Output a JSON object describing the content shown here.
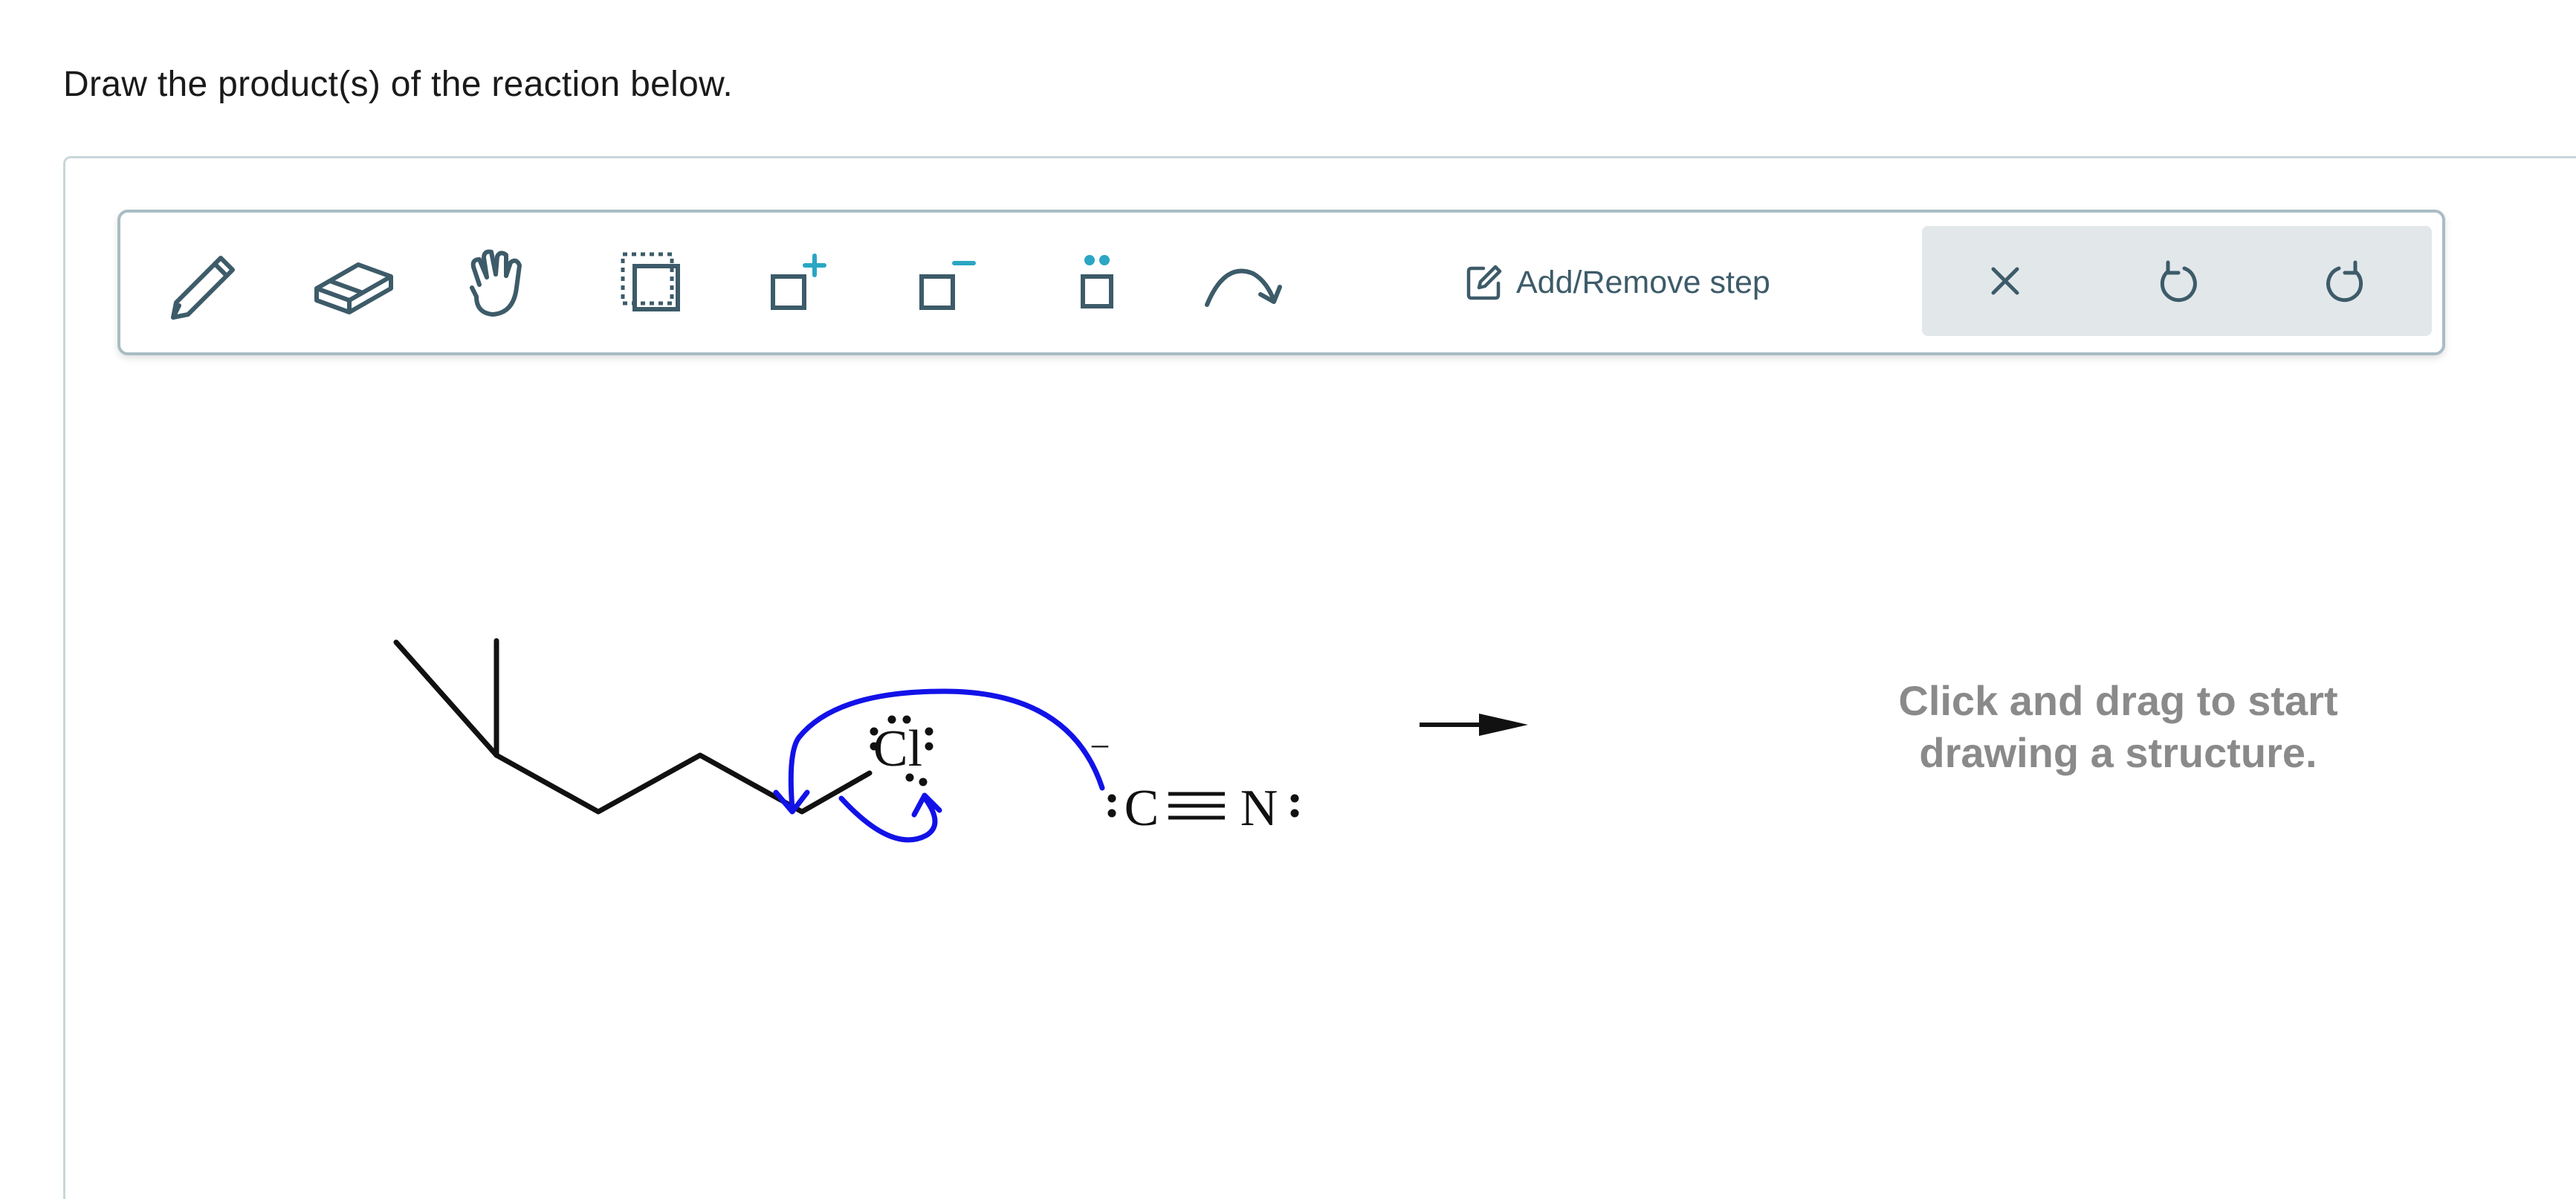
{
  "question": {
    "prompt": "Draw the product(s) of the reaction below."
  },
  "toolbar": {
    "tools": [
      {
        "name": "pencil-tool",
        "icon": "pencil-icon"
      },
      {
        "name": "eraser-tool",
        "icon": "eraser-icon"
      },
      {
        "name": "hand-tool",
        "icon": "hand-icon"
      },
      {
        "name": "select-tool",
        "icon": "selection-icon"
      },
      {
        "name": "increase-charge-tool",
        "icon": "charge-plus-icon"
      },
      {
        "name": "decrease-charge-tool",
        "icon": "charge-minus-icon"
      },
      {
        "name": "lone-pair-tool",
        "icon": "lone-pair-icon"
      },
      {
        "name": "arrow-tool",
        "icon": "curved-arrow-icon"
      }
    ],
    "add_remove_step_label": "Add/Remove step",
    "clear_icon": "close-icon",
    "undo_icon": "undo-icon",
    "redo_icon": "redo-icon",
    "accent_color": "#2ba6c4",
    "icon_color": "#3d5b69"
  },
  "reaction": {
    "leaving_group": "Cl",
    "nucleophile_c": "C",
    "nucleophile_n": "N",
    "nucleophile_charge": "–",
    "mechanism_arrow_color": "#1212e8"
  },
  "drawing_area": {
    "hint_line1": "Click and drag to start",
    "hint_line2": "drawing a structure."
  }
}
